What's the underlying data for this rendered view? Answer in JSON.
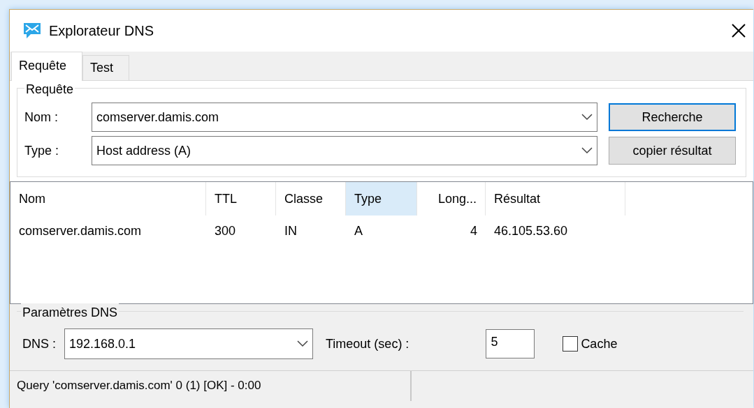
{
  "window": {
    "title": "Explorateur DNS"
  },
  "tabs": [
    {
      "label": "Requête",
      "selected": true
    },
    {
      "label": "Test",
      "selected": false
    }
  ],
  "query": {
    "title": "Requête",
    "fields": [
      {
        "label": "Nom :",
        "value": "comserver.damis.com"
      },
      {
        "label": "Type :",
        "value": "Host address (A)"
      }
    ],
    "buttons": [
      {
        "label": "Recherche",
        "default": true
      },
      {
        "label": "copier résultat",
        "default": false
      }
    ]
  },
  "table": {
    "columns": [
      {
        "label": "Nom",
        "sorted": false,
        "right_aligned": false
      },
      {
        "label": "TTL",
        "sorted": false,
        "right_aligned": false
      },
      {
        "label": "Classe",
        "sorted": false,
        "right_aligned": false
      },
      {
        "label": "Type",
        "sorted": true,
        "right_aligned": false
      },
      {
        "label": "Long...",
        "sorted": false,
        "right_aligned": true
      },
      {
        "label": "Résultat",
        "sorted": false,
        "right_aligned": false
      }
    ],
    "rows": [
      [
        "comserver.damis.com",
        "300",
        "IN",
        "A",
        "4",
        "46.105.53.60"
      ]
    ]
  },
  "dns_settings": {
    "title": "Paramètres DNS",
    "dns_label": "DNS :",
    "dns_value": "192.168.0.1",
    "timeout_label": "Timeout (sec) :",
    "timeout_value": "5",
    "cache": {
      "label": "Cache",
      "checked": false
    }
  },
  "status_bar": {
    "text": "Query 'comserver.damis.com' 0 (1) [OK] - 0:00"
  }
}
